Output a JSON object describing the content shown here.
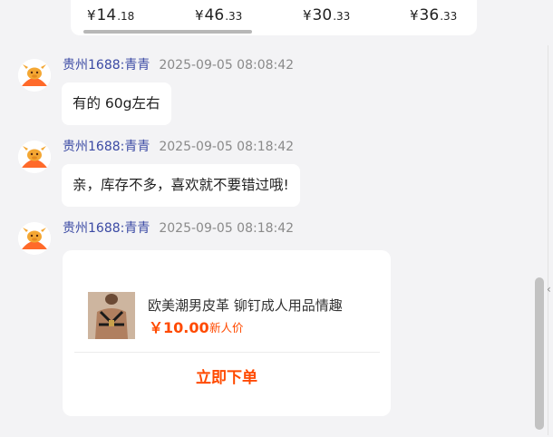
{
  "top_card": {
    "currency": "¥",
    "prices": [
      {
        "main": "14",
        "cents": ".18"
      },
      {
        "main": "46",
        "cents": ".33"
      },
      {
        "main": "30",
        "cents": ".33"
      },
      {
        "main": "36",
        "cents": ".33"
      }
    ]
  },
  "messages": [
    {
      "sender": "贵州1688:青青",
      "time": "2025-09-05 08:08:42",
      "text": "有的   60g左右"
    },
    {
      "sender": "贵州1688:青青",
      "time": "2025-09-05 08:18:42",
      "text": "亲，库存不多，喜欢就不要错过哦!"
    },
    {
      "sender": "贵州1688:青青",
      "time": "2025-09-05 08:18:42"
    }
  ],
  "product": {
    "title": "欧美潮男皮革 铆钉成人用品情趣",
    "price": "￥10.00",
    "tag": "新人价",
    "buy_label": "立即下单"
  },
  "colors": {
    "accent": "#ff4a00",
    "sender": "#3b4aa4",
    "background": "#f3f3f5"
  },
  "icons": {
    "avatar": "bull-mascot-avatar-icon",
    "scroll_arrow": "chevron-left-icon"
  }
}
